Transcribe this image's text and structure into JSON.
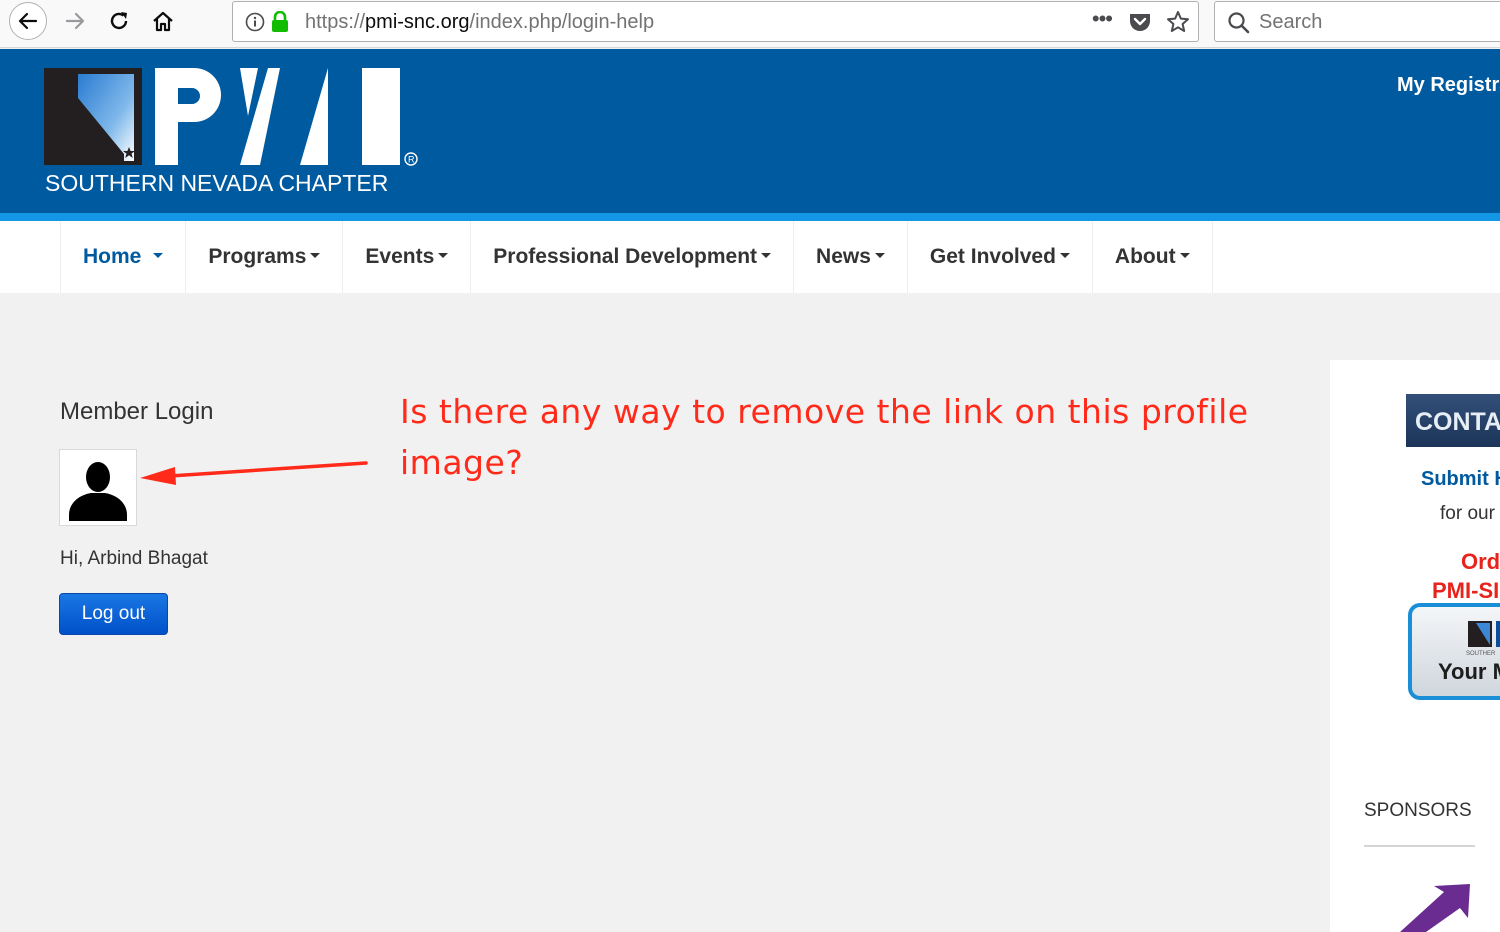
{
  "browser": {
    "url_scheme": "https://",
    "url_host": "pmi-snc.org",
    "url_path": "/index.php/login-help",
    "search_placeholder": "Search",
    "icons": [
      "back-arrow-icon",
      "forward-arrow-icon",
      "reload-icon",
      "home-icon",
      "info-icon",
      "lock-icon",
      "more-dots-icon",
      "pocket-icon",
      "bookmark-star-icon",
      "search-icon"
    ]
  },
  "header": {
    "logo_tagline": "SOUTHERN NEVADA CHAPTER",
    "registration_link": "My Registra",
    "colors": {
      "brand_blue": "#005aa0",
      "accent_blue": "#1496e6"
    }
  },
  "nav": {
    "items": [
      {
        "label": "Home"
      },
      {
        "label": "Programs"
      },
      {
        "label": "Events"
      },
      {
        "label": "Professional Development"
      },
      {
        "label": "News"
      },
      {
        "label": "Get Involved"
      },
      {
        "label": "About"
      }
    ]
  },
  "login": {
    "title": "Member Login",
    "greeting": "Hi, Arbind Bhagat",
    "logout_label": "Log out"
  },
  "annotation": {
    "text": "Is there any way to remove the link on this profile image?",
    "color": "#ff2a1a"
  },
  "sidebar": {
    "contact_banner": "CONTAC",
    "submit_link": "Submit H",
    "for_our": "for our",
    "order_line1": "Ord",
    "order_line2": "PMI-SI",
    "badge_small": "SOUTHER",
    "badge_text": "Your M",
    "sponsors_title": "SPONSORS"
  }
}
